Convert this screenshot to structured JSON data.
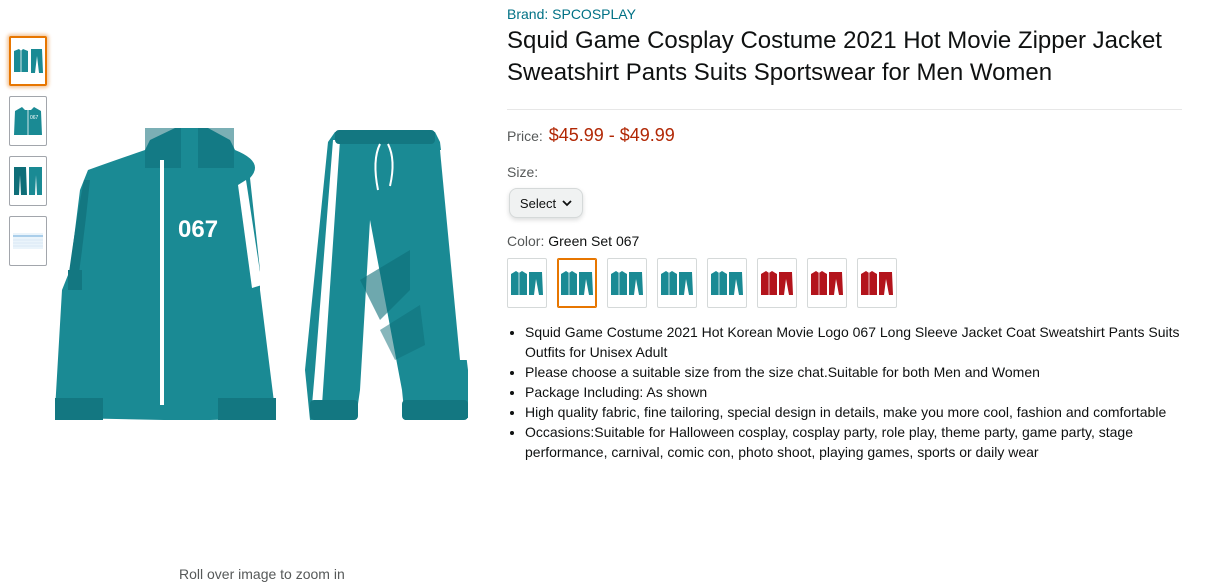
{
  "gallery": {
    "thumbnails": [
      {
        "name": "thumb-full-set",
        "selected": true
      },
      {
        "name": "thumb-jacket",
        "selected": false
      },
      {
        "name": "thumb-pants",
        "selected": false
      },
      {
        "name": "thumb-size-chart",
        "selected": false
      }
    ],
    "main_image": {
      "jacket_number": "067",
      "colors": {
        "teal": "#1a8a94",
        "dark_teal": "#0e6e78",
        "white": "#ffffff"
      }
    },
    "zoom_hint": "Roll over image to zoom in"
  },
  "product": {
    "brand": "Brand: SPCOSPLAY",
    "title": "Squid Game Cosplay Costume 2021 Hot Movie Zipper Jacket Sweatshirt Pants Suits Sportswear for Men Women",
    "price_label": "Price:",
    "price": "$45.99 - $49.99",
    "size_label": "Size:",
    "size_select": "Select",
    "color_label": "Color:",
    "color_value": "Green Set 067",
    "color_options": [
      {
        "color": "#1a8a94",
        "selected": false
      },
      {
        "color": "#1a8a94",
        "selected": true
      },
      {
        "color": "#1a8a94",
        "selected": false
      },
      {
        "color": "#1a8a94",
        "selected": false
      },
      {
        "color": "#1a8a94",
        "selected": false
      },
      {
        "color": "#b3141c",
        "selected": false
      },
      {
        "color": "#b3141c",
        "selected": false
      },
      {
        "color": "#b3141c",
        "selected": false
      }
    ],
    "bullets": [
      "Squid Game Costume 2021 Hot Korean Movie Logo 067 Long Sleeve Jacket Coat Sweatshirt Pants Suits Outfits for Unisex Adult",
      "Please choose a suitable size from the size chat.Suitable for both Men and Women",
      "Package Including: As shown",
      "High quality fabric, fine tailoring, special design in details, make you more cool, fashion and comfortable",
      "Occasions:Suitable for Halloween cosplay, cosplay party, role play, theme party, game party, stage performance, carnival, comic con, photo shoot, playing games, sports or daily wear"
    ]
  }
}
